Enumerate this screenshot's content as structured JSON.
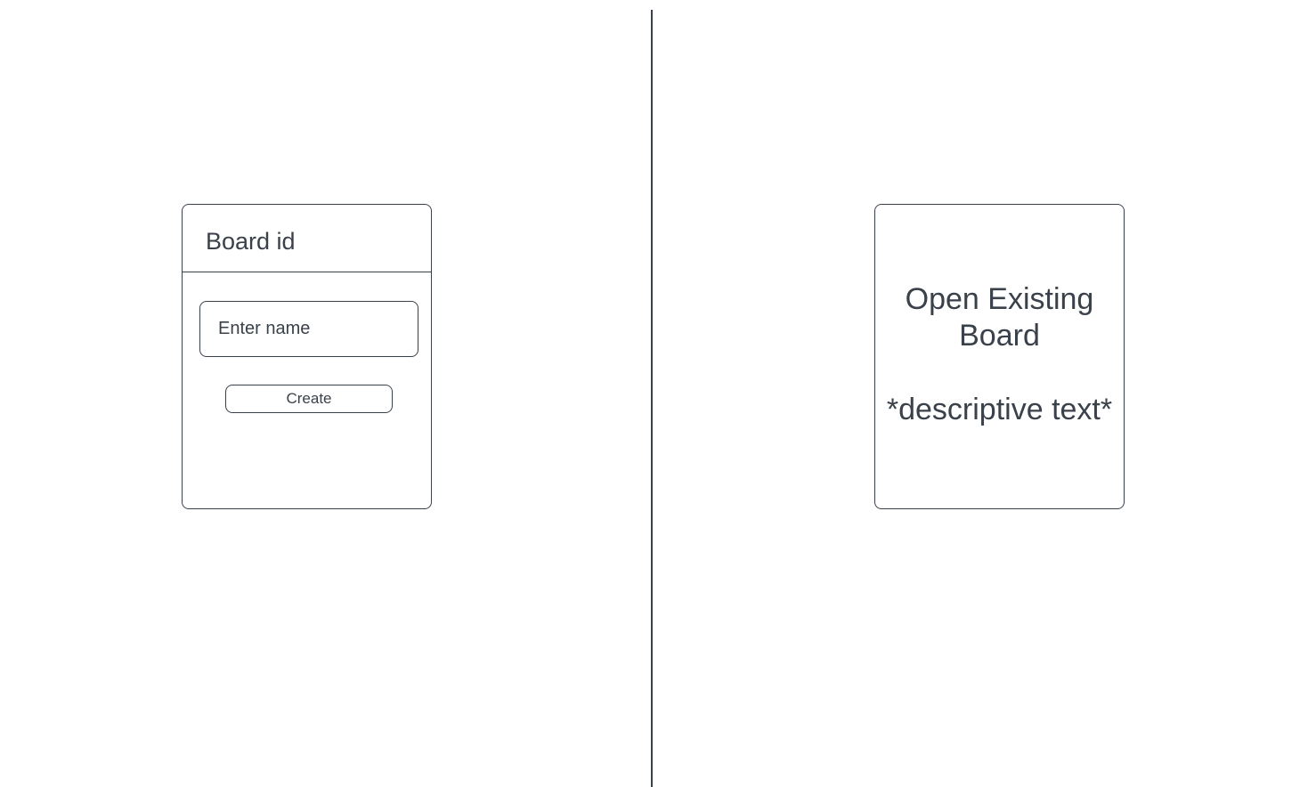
{
  "create_card": {
    "title": "Board id",
    "name_input": {
      "placeholder": "Enter name",
      "value": ""
    },
    "create_label": "Create"
  },
  "open_card": {
    "title": "Open Existing Board",
    "description": "*descriptive text*"
  },
  "colors": {
    "stroke": "#3a414a",
    "background": "#ffffff"
  }
}
